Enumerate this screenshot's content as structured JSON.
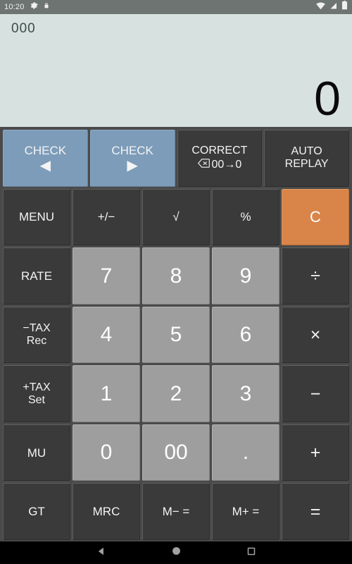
{
  "statusbar": {
    "time": "10:20",
    "left_icons": [
      "gear-icon",
      "lock-icon"
    ],
    "right_icons": [
      "wifi-icon",
      "cell-signal-icon",
      "battery-icon"
    ]
  },
  "display": {
    "memory_value": "000",
    "main_value": "0",
    "background_color": "#d7e2e0"
  },
  "colors": {
    "accent_orange": "#d98449",
    "check_blue": "#7d9cb9",
    "number_key": "#9e9e9e",
    "function_key": "#3a3a3a",
    "keypad_background": "#4a4a4a"
  },
  "keypad": {
    "rows": [
      [
        {
          "label": "CHECK",
          "arrow": "◀",
          "style": "blue",
          "name": "check-back-button"
        },
        {
          "label": "CHECK",
          "arrow": "▶",
          "style": "blue",
          "name": "check-forward-button"
        },
        {
          "label": "CORRECT",
          "sub": "00→0",
          "icon": "backspace-icon",
          "style": "fn",
          "name": "correct-button"
        },
        {
          "label": "AUTO",
          "line2": "REPLAY",
          "style": "fn",
          "name": "auto-replay-button"
        }
      ],
      [
        {
          "label": "MENU",
          "style": "fn",
          "name": "menu-button"
        },
        {
          "label": "+/−",
          "style": "fn",
          "name": "sign-toggle-button"
        },
        {
          "label": "√",
          "style": "fn",
          "name": "square-root-button"
        },
        {
          "label": "%",
          "style": "fn",
          "name": "percent-button"
        },
        {
          "label": "C",
          "style": "accent",
          "name": "clear-button"
        }
      ],
      [
        {
          "label": "RATE",
          "style": "fn",
          "name": "rate-button"
        },
        {
          "label": "7",
          "style": "num",
          "name": "digit-7-button"
        },
        {
          "label": "8",
          "style": "num",
          "name": "digit-8-button"
        },
        {
          "label": "9",
          "style": "num",
          "name": "digit-9-button"
        },
        {
          "label": "÷",
          "style": "op",
          "name": "divide-button"
        }
      ],
      [
        {
          "label": "−TAX",
          "line2": "Rec",
          "style": "fn",
          "name": "tax-minus-button"
        },
        {
          "label": "4",
          "style": "num",
          "name": "digit-4-button"
        },
        {
          "label": "5",
          "style": "num",
          "name": "digit-5-button"
        },
        {
          "label": "6",
          "style": "num",
          "name": "digit-6-button"
        },
        {
          "label": "×",
          "style": "op",
          "name": "multiply-button"
        }
      ],
      [
        {
          "label": "+TAX",
          "line2": "Set",
          "style": "fn",
          "name": "tax-plus-button"
        },
        {
          "label": "1",
          "style": "num",
          "name": "digit-1-button"
        },
        {
          "label": "2",
          "style": "num",
          "name": "digit-2-button"
        },
        {
          "label": "3",
          "style": "num",
          "name": "digit-3-button"
        },
        {
          "label": "−",
          "style": "op",
          "name": "subtract-button"
        }
      ],
      [
        {
          "label": "MU",
          "style": "fn",
          "name": "markup-button"
        },
        {
          "label": "0",
          "style": "num",
          "name": "digit-0-button"
        },
        {
          "label": "00",
          "style": "num",
          "name": "digit-00-button"
        },
        {
          "label": ".",
          "style": "num",
          "name": "decimal-point-button"
        },
        {
          "label": "+",
          "style": "op",
          "name": "add-button"
        }
      ],
      [
        {
          "label": "GT",
          "style": "fn",
          "name": "grand-total-button"
        },
        {
          "label": "MRC",
          "style": "fn",
          "name": "memory-recall-clear-button"
        },
        {
          "label": "M− =",
          "style": "fn",
          "name": "memory-minus-button"
        },
        {
          "label": "M+ =",
          "style": "fn",
          "name": "memory-plus-button"
        },
        {
          "label": "=",
          "style": "op",
          "name": "equals-button"
        }
      ]
    ]
  },
  "navbar": {
    "buttons": [
      "back-nav-icon",
      "home-nav-icon",
      "recents-nav-icon"
    ]
  }
}
